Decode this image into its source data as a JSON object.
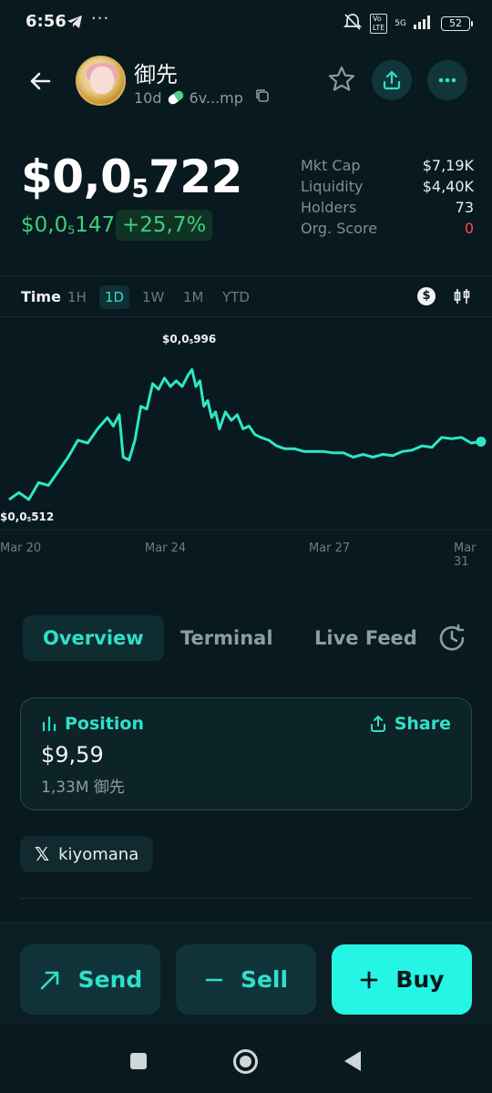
{
  "status_bar": {
    "time": "6:56",
    "network": "5G",
    "battery": "52"
  },
  "token": {
    "name": "御先",
    "age": "10d",
    "address_short": "6v...mp"
  },
  "price": {
    "main_prefix": "$0,0",
    "main_zeros": "5",
    "main_digits": "722",
    "sub_prefix": "$0,0",
    "sub_zeros": "5",
    "sub_digits": "147",
    "change": "+25,7%"
  },
  "stats": [
    {
      "label": "Mkt Cap",
      "value": "$7,19K"
    },
    {
      "label": "Liquidity",
      "value": "$4,40K"
    },
    {
      "label": "Holders",
      "value": "73"
    },
    {
      "label": "Org. Score",
      "value": "0"
    }
  ],
  "timeframes": {
    "label": "Time",
    "items": [
      "1H",
      "1D",
      "1W",
      "1M",
      "YTD"
    ],
    "active": "1D"
  },
  "chart_data": {
    "type": "line",
    "x_labels": [
      "Mar 20",
      "Mar 24",
      "Mar 27",
      "Mar 31"
    ],
    "high_prefix": "$0,0",
    "high_zeros": "5",
    "high_digits": "996",
    "low_prefix": "$0,0",
    "low_zeros": "5",
    "low_digits": "512",
    "color": "#2fe6c6",
    "points": [
      [
        0.0,
        0.0
      ],
      [
        0.5,
        0.05
      ],
      [
        1.0,
        0.0
      ],
      [
        1.5,
        0.12
      ],
      [
        2.0,
        0.1
      ],
      [
        2.5,
        0.2
      ],
      [
        3.0,
        0.3
      ],
      [
        3.5,
        0.42
      ],
      [
        4.0,
        0.4
      ],
      [
        4.5,
        0.5
      ],
      [
        5.0,
        0.58
      ],
      [
        5.3,
        0.52
      ],
      [
        5.6,
        0.6
      ],
      [
        5.8,
        0.3
      ],
      [
        6.1,
        0.28
      ],
      [
        6.4,
        0.42
      ],
      [
        6.7,
        0.66
      ],
      [
        7.0,
        0.64
      ],
      [
        7.3,
        0.82
      ],
      [
        7.6,
        0.78
      ],
      [
        7.9,
        0.86
      ],
      [
        8.2,
        0.8
      ],
      [
        8.5,
        0.84
      ],
      [
        8.8,
        0.8
      ],
      [
        9.1,
        0.88
      ],
      [
        9.3,
        0.92
      ],
      [
        9.5,
        0.8
      ],
      [
        9.7,
        0.84
      ],
      [
        9.9,
        0.66
      ],
      [
        10.1,
        0.7
      ],
      [
        10.3,
        0.58
      ],
      [
        10.5,
        0.62
      ],
      [
        10.7,
        0.5
      ],
      [
        11.0,
        0.62
      ],
      [
        11.3,
        0.56
      ],
      [
        11.6,
        0.6
      ],
      [
        11.9,
        0.5
      ],
      [
        12.2,
        0.52
      ],
      [
        12.5,
        0.46
      ],
      [
        12.8,
        0.44
      ],
      [
        13.2,
        0.42
      ],
      [
        13.6,
        0.38
      ],
      [
        14.0,
        0.36
      ],
      [
        14.5,
        0.36
      ],
      [
        15.0,
        0.34
      ],
      [
        15.5,
        0.34
      ],
      [
        16.0,
        0.34
      ],
      [
        16.5,
        0.33
      ],
      [
        17.0,
        0.33
      ],
      [
        17.5,
        0.3
      ],
      [
        18.0,
        0.32
      ],
      [
        18.5,
        0.3
      ],
      [
        19.0,
        0.32
      ],
      [
        19.5,
        0.31
      ],
      [
        20.0,
        0.34
      ],
      [
        20.5,
        0.35
      ],
      [
        21.0,
        0.38
      ],
      [
        21.5,
        0.37
      ],
      [
        22.0,
        0.44
      ],
      [
        22.5,
        0.43
      ],
      [
        23.0,
        0.44
      ],
      [
        23.5,
        0.4
      ],
      [
        24.0,
        0.41
      ]
    ],
    "y_range": [
      0,
      1
    ],
    "x_range": [
      0,
      24
    ]
  },
  "tabs": {
    "items": [
      "Overview",
      "Terminal",
      "Live Feed"
    ],
    "active": "Overview"
  },
  "position": {
    "title": "Position",
    "share_label": "Share",
    "value": "$9,59",
    "amount": "1,33M 御先"
  },
  "social": {
    "handle": "kiyomana"
  },
  "actions": {
    "send": "Send",
    "sell": "Sell",
    "buy": "Buy"
  }
}
